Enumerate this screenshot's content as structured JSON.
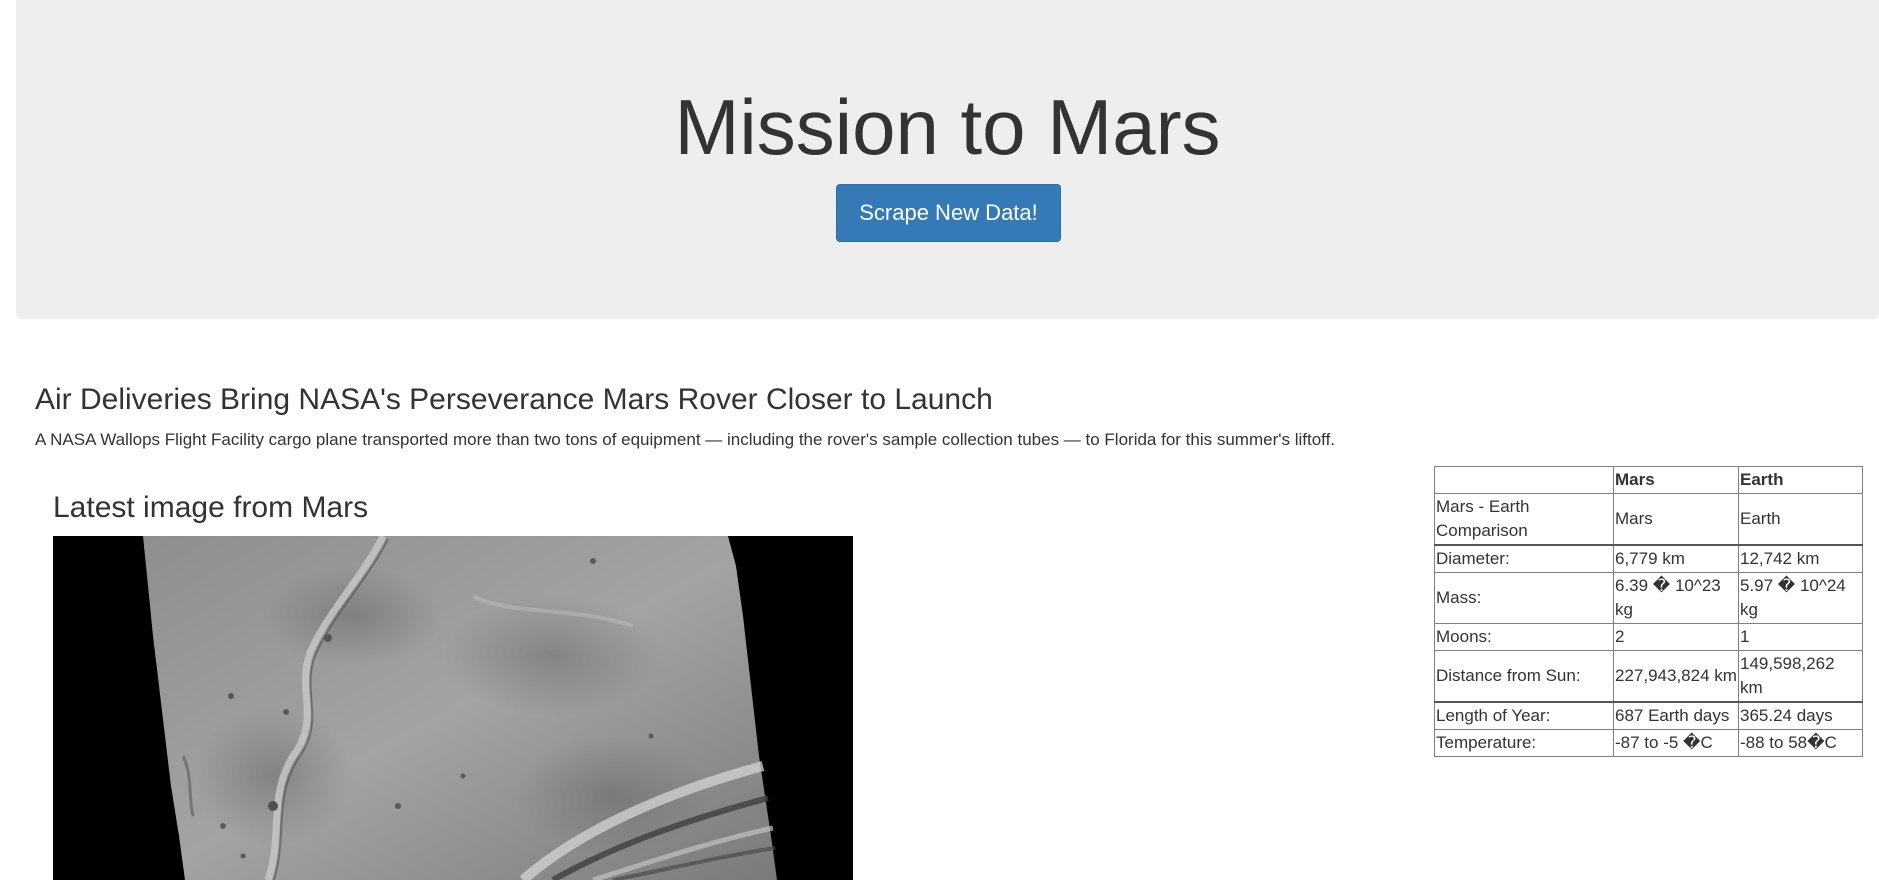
{
  "header": {
    "title": "Mission to Mars",
    "scrape_button_label": "Scrape New Data!"
  },
  "news": {
    "title": "Air Deliveries Bring NASA's Perseverance Mars Rover Closer to Launch",
    "teaser": "A NASA Wallops Flight Facility cargo plane transported more than two tons of equipment — including the rover's sample collection tubes — to Florida for this summer's liftoff."
  },
  "featured_image": {
    "heading": "Latest image from Mars"
  },
  "facts_table": {
    "columns": [
      "",
      "Mars",
      "Earth"
    ],
    "rows": [
      [
        "Mars - Earth Comparison",
        "Mars",
        "Earth"
      ],
      [
        "Diameter:",
        "6,779 km",
        "12,742 km"
      ],
      [
        "Mass:",
        "6.39 � 10^23 kg",
        "5.97 � 10^24 kg"
      ],
      [
        "Moons:",
        "2",
        "1"
      ],
      [
        "Distance from Sun:",
        "227,943,824 km",
        "149,598,262 km"
      ],
      [
        "Length of Year:",
        "687 Earth days",
        "365.24 days"
      ],
      [
        "Temperature:",
        "-87 to -5 �C",
        "-88 to 58�C"
      ]
    ]
  },
  "colors": {
    "jumbotron_bg": "#eeeeee",
    "button_bg": "#337ab7",
    "text": "#333333"
  }
}
